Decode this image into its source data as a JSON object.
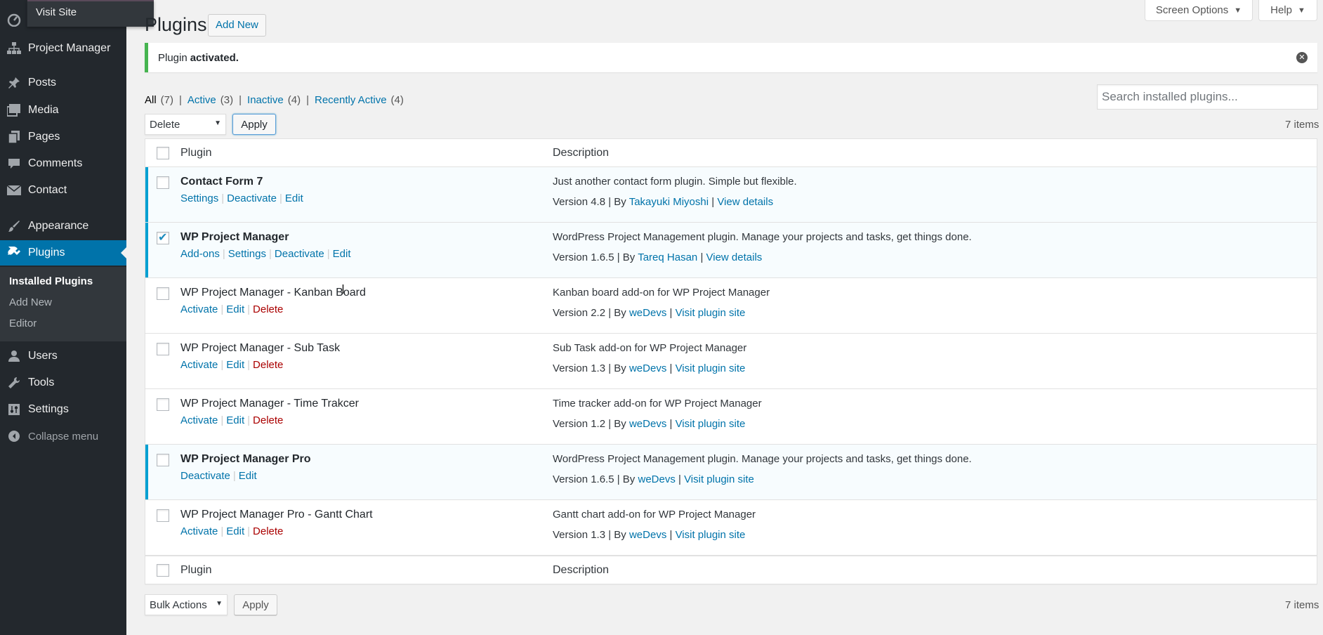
{
  "admin_bar": {
    "visit_site": "Visit Site"
  },
  "sidebar": {
    "items": [
      {
        "label": "Project Manager",
        "icon": "sitemap-icon"
      },
      {
        "label": "Posts",
        "icon": "pin-icon"
      },
      {
        "label": "Media",
        "icon": "media-icon"
      },
      {
        "label": "Pages",
        "icon": "pages-icon"
      },
      {
        "label": "Comments",
        "icon": "comments-icon"
      },
      {
        "label": "Contact",
        "icon": "envelope-icon"
      },
      {
        "label": "Appearance",
        "icon": "brush-icon"
      },
      {
        "label": "Plugins",
        "icon": "plugin-icon"
      },
      {
        "label": "Users",
        "icon": "users-icon"
      },
      {
        "label": "Tools",
        "icon": "wrench-icon"
      },
      {
        "label": "Settings",
        "icon": "settings-icon"
      }
    ],
    "submenu": [
      "Installed Plugins",
      "Add New",
      "Editor"
    ],
    "collapse": "Collapse menu"
  },
  "header": {
    "title": "Plugins",
    "add_new": "Add New",
    "screen_options": "Screen Options",
    "help": "Help"
  },
  "notice": {
    "prefix": "Plugin",
    "strong": "activated."
  },
  "filters": {
    "all": "All",
    "all_count": "(7)",
    "active": "Active",
    "active_count": "(3)",
    "inactive": "Inactive",
    "inactive_count": "(4)",
    "recent": "Recently Active",
    "recent_count": "(4)"
  },
  "search": {
    "placeholder": "Search installed plugins..."
  },
  "top_bulk": {
    "selected": "Delete",
    "apply": "Apply",
    "items": "7 items"
  },
  "bottom_bulk": {
    "selected": "Bulk Actions",
    "apply": "Apply",
    "items": "7 items"
  },
  "table": {
    "col_plugin": "Plugin",
    "col_description": "Description",
    "rows": [
      {
        "name": "Contact Form 7",
        "a1": "Settings",
        "a2": "Deactivate",
        "a3": "Edit",
        "desc": "Just another contact form plugin. Simple but flexible.",
        "version": "Version 4.8 | By",
        "author": "Takayuki Miyoshi",
        "link": "View details"
      },
      {
        "name": "WP Project Manager",
        "a0": "Add-ons",
        "a1": "Settings",
        "a2": "Deactivate",
        "a3": "Edit",
        "desc": "WordPress Project Management plugin. Manage your projects and tasks, get things done.",
        "version": "Version 1.6.5 | By",
        "author": "Tareq Hasan",
        "link": "View details"
      },
      {
        "name": "WP Project Manager - Kanban Board",
        "a1": "Activate",
        "a2": "Edit",
        "a3": "Delete",
        "desc": "Kanban board add-on for WP Project Manager",
        "version": "Version 2.2 | By",
        "author": "weDevs",
        "link": "Visit plugin site"
      },
      {
        "name": "WP Project Manager - Sub Task",
        "a1": "Activate",
        "a2": "Edit",
        "a3": "Delete",
        "desc": "Sub Task add-on for WP Project Manager",
        "version": "Version 1.3 | By",
        "author": "weDevs",
        "link": "Visit plugin site"
      },
      {
        "name": "WP Project Manager - Time Trakcer",
        "a1": "Activate",
        "a2": "Edit",
        "a3": "Delete",
        "desc": "Time tracker add-on for WP Project Manager",
        "version": "Version 1.2 | By",
        "author": "weDevs",
        "link": "Visit plugin site"
      },
      {
        "name": "WP Project Manager Pro",
        "a1": "Deactivate",
        "a2": "Edit",
        "desc": "WordPress Project Management plugin. Manage your projects and tasks, get things done.",
        "version": "Version 1.6.5 | By",
        "author": "weDevs",
        "link": "Visit plugin site"
      },
      {
        "name": "WP Project Manager Pro - Gantt Chart",
        "a1": "Activate",
        "a2": "Edit",
        "a3": "Delete",
        "desc": "Gantt chart add-on for WP Project Manager",
        "version": "Version 1.3 | By",
        "author": "weDevs",
        "link": "Visit plugin site"
      }
    ]
  },
  "colors": {
    "sidebar_bg": "#23282d",
    "accent": "#0073aa",
    "active_row_border": "#00a0d2",
    "notice_success": "#46b450",
    "delete_red": "#a00"
  }
}
